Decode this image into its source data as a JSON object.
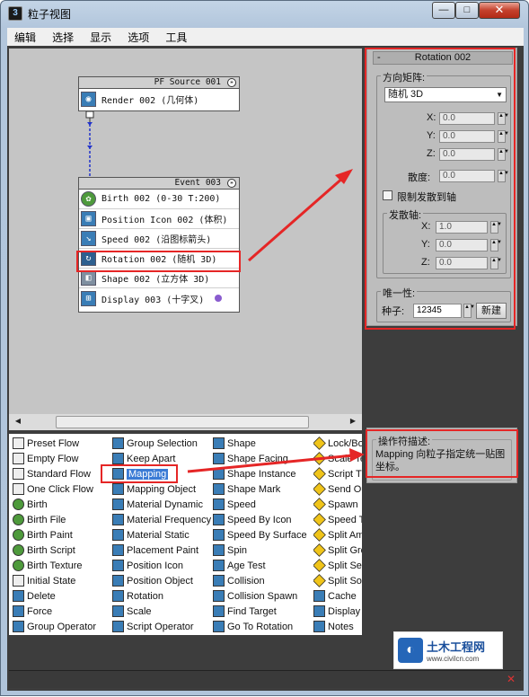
{
  "window": {
    "title": "粒子视图",
    "min": "—",
    "max": "□",
    "close": "✕",
    "app_icon": "3ds-max-icon"
  },
  "menu": [
    "编辑",
    "选择",
    "显示",
    "选项",
    "工具"
  ],
  "graph": {
    "source": {
      "header": "PF Source 001",
      "ops": [
        {
          "label": "Render 002 (几何体)",
          "icon": "render-icon"
        }
      ]
    },
    "event": {
      "header": "Event 003",
      "ops": [
        {
          "label": "Birth 002 (0-30 T:200)",
          "icon": "birth-icon"
        },
        {
          "label": "Position Icon 002 (体积)",
          "icon": "position-icon"
        },
        {
          "label": "Speed 002 (沿图标箭头)",
          "icon": "speed-icon"
        },
        {
          "label": "Rotation 002 (随机 3D)",
          "icon": "rotation-icon"
        },
        {
          "label": "Shape 002 (立方体 3D)",
          "icon": "shape-icon"
        },
        {
          "label": "Display 003 (十字叉)",
          "icon": "display-icon"
        }
      ]
    }
  },
  "panel": {
    "rollout_title": "Rotation 002",
    "collapse": "-",
    "orientation_group": "方向矩阵:",
    "orientation_value": "随机 3D",
    "x_label": "X:",
    "y_label": "Y:",
    "z_label": "Z:",
    "x_value": "0.0",
    "y_value": "0.0",
    "z_value": "0.0",
    "divergence_label": "散度:",
    "divergence_value": "0.0",
    "restrict_label": "限制发散到轴",
    "axis_group": "发散轴:",
    "axis_x_label": "X:",
    "axis_y_label": "Y:",
    "axis_z_label": "Z:",
    "axis_x": "1.0",
    "axis_y": "0.0",
    "axis_z": "0.0",
    "uniqueness_group": "唯一性:",
    "seed_label": "种子:",
    "seed_value": "12345",
    "new_button": "新建"
  },
  "description": {
    "label": "操作符描述:",
    "text": "Mapping 向粒子指定统一贴图坐标。"
  },
  "operators": {
    "col1": [
      "Preset Flow",
      "Empty Flow",
      "Standard Flow",
      "One Click Flow",
      "Birth",
      "Birth File",
      "Birth Paint",
      "Birth Script",
      "Birth Texture",
      "Initial State",
      "Delete",
      "Force",
      "Group Operator"
    ],
    "col2": [
      "Group Selection",
      "Keep Apart",
      "Mapping",
      "Mapping Object",
      "Material Dynamic",
      "Material Frequency",
      "Material Static",
      "Placement Paint",
      "Position Icon",
      "Position Object",
      "Rotation",
      "Scale",
      "Script Operator"
    ],
    "col3": [
      "Shape",
      "Shape Facing",
      "Shape Instance",
      "Shape Mark",
      "Speed",
      "Speed By Icon",
      "Speed By Surface",
      "Spin",
      "Age Test",
      "Collision",
      "Collision Spawn",
      "Find Target",
      "Go To Rotation"
    ],
    "col4": [
      "Lock/Bo",
      "Scale Te",
      "Script T",
      "Send Ou",
      "Spawn",
      "Speed T",
      "Split Am",
      "Split Gro",
      "Split Sel",
      "Split Sou",
      "Cache",
      "Display",
      "Notes"
    ]
  },
  "watermark": {
    "line1": "土木工程网",
    "line2": "www.civilcn.com"
  },
  "colors": {
    "highlight": "#e52626",
    "selection": "#3a7bd5"
  }
}
